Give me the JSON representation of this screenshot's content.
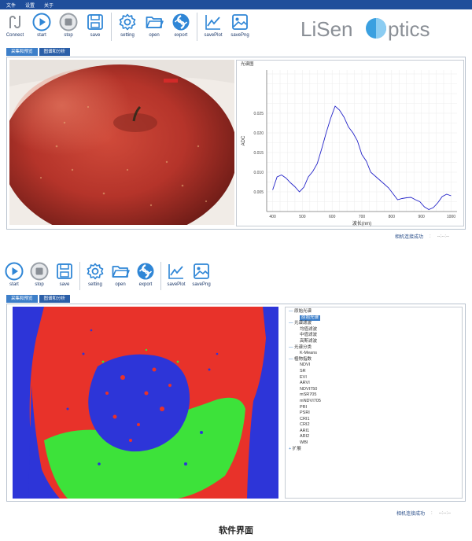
{
  "menu": [
    "文件",
    "设置",
    "关于"
  ],
  "toolbar_top": {
    "buttons": [
      {
        "label": "Connect",
        "icon": "connect-icon"
      },
      {
        "label": "start",
        "icon": "play-icon"
      },
      {
        "label": "stop",
        "icon": "stop-icon"
      },
      {
        "label": "save",
        "icon": "save-icon"
      },
      {
        "label": "setting",
        "icon": "gear-icon"
      },
      {
        "label": "open",
        "icon": "folder-icon"
      },
      {
        "label": "export",
        "icon": "export-icon"
      },
      {
        "label": "savePlot",
        "icon": "line-chart-icon"
      },
      {
        "label": "savePng",
        "icon": "image-icon"
      }
    ]
  },
  "brand": {
    "name": "LiSen Optics",
    "part1": "LiSen",
    "part2": "ptics",
    "color": "#8a8f96",
    "accent": "#3aa0e0"
  },
  "tabs_top": [
    "采集和预览",
    "图谱和分析"
  ],
  "tabs_bottom": [
    "采集和预览",
    "图谱和分析"
  ],
  "chart_panel_label": "光谱图",
  "status_text": "相机连接成功",
  "status_sep": ":",
  "status_value": "--:--:--",
  "toolbar_bottom": {
    "buttons": [
      {
        "label": "start",
        "icon": "play-icon"
      },
      {
        "label": "stop",
        "icon": "stop-icon"
      },
      {
        "label": "save",
        "icon": "save-icon"
      },
      {
        "label": "setting",
        "icon": "gear-icon"
      },
      {
        "label": "open",
        "icon": "folder-icon"
      },
      {
        "label": "export",
        "icon": "export-icon"
      },
      {
        "label": "savePlot",
        "icon": "line-chart-icon"
      },
      {
        "label": "savePng",
        "icon": "image-icon"
      }
    ]
  },
  "tree": {
    "groups": [
      {
        "label": "原始光谱",
        "children": [
          "原始光谱"
        ]
      },
      {
        "label": "光谱滤波",
        "children": [
          "均值滤波",
          "中值滤波",
          "高斯滤波"
        ]
      },
      {
        "label": "光谱分类",
        "children": [
          "K-Means"
        ]
      },
      {
        "label": "植物指数",
        "children": [
          "NDVI",
          "SR",
          "EVI",
          "ARVI",
          "NDVI750",
          "mSR705",
          "mNDVI705",
          "PRI",
          "PSRI",
          "CRI1",
          "CRI2",
          "ARI1",
          "ARI2",
          "WBI"
        ]
      },
      {
        "label": "扩展",
        "children": []
      }
    ],
    "selected": "原始光谱"
  },
  "caption": "软件界面",
  "colors": {
    "menubar": "#1f4e9b",
    "accent": "#3d7fc9",
    "class_red": "#e8322a",
    "class_green": "#3de23a",
    "class_blue": "#2d35d8"
  },
  "chart_data": {
    "type": "line",
    "title": "光谱图",
    "xlabel": "波长(nm)",
    "ylabel": "ADC",
    "xlim": [
      380,
      1020
    ],
    "ylim": [
      0,
      0.036
    ],
    "xticks": [
      400,
      500,
      600,
      700,
      800,
      900,
      1000
    ],
    "yticks": [
      0.005,
      0.01,
      0.015,
      0.02,
      0.025
    ],
    "ytick_labels": [
      "0.005",
      "0.010",
      "0.015",
      "0.020",
      "0.025"
    ],
    "grid": true,
    "series": [
      {
        "color": "#2323c8",
        "x": [
          400,
          415,
          430,
          445,
          460,
          475,
          490,
          505,
          520,
          535,
          550,
          565,
          580,
          595,
          610,
          625,
          640,
          655,
          670,
          685,
          700,
          715,
          730,
          745,
          760,
          775,
          790,
          805,
          820,
          835,
          850,
          865,
          880,
          895,
          910,
          925,
          940,
          955,
          970,
          985,
          1000
        ],
        "y": [
          0.0055,
          0.0088,
          0.0093,
          0.0085,
          0.0073,
          0.0063,
          0.005,
          0.0062,
          0.0088,
          0.0102,
          0.0122,
          0.016,
          0.02,
          0.0237,
          0.0268,
          0.0258,
          0.024,
          0.0215,
          0.02,
          0.018,
          0.0145,
          0.0128,
          0.01,
          0.009,
          0.008,
          0.007,
          0.006,
          0.0045,
          0.003,
          0.0033,
          0.0035,
          0.0036,
          0.003,
          0.0025,
          0.0012,
          0.0005,
          0.001,
          0.0022,
          0.0038,
          0.0044,
          0.004
        ]
      }
    ]
  }
}
